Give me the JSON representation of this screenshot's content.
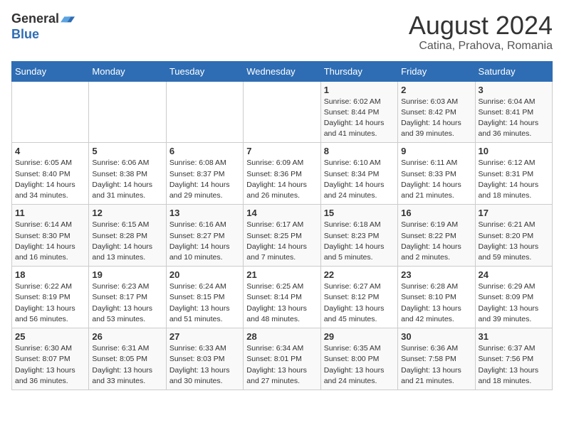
{
  "header": {
    "logo_general": "General",
    "logo_blue": "Blue",
    "month_title": "August 2024",
    "location": "Catina, Prahova, Romania"
  },
  "days_of_week": [
    "Sunday",
    "Monday",
    "Tuesday",
    "Wednesday",
    "Thursday",
    "Friday",
    "Saturday"
  ],
  "weeks": [
    [
      {
        "num": "",
        "info": ""
      },
      {
        "num": "",
        "info": ""
      },
      {
        "num": "",
        "info": ""
      },
      {
        "num": "",
        "info": ""
      },
      {
        "num": "1",
        "info": "Sunrise: 6:02 AM\nSunset: 8:44 PM\nDaylight: 14 hours\nand 41 minutes."
      },
      {
        "num": "2",
        "info": "Sunrise: 6:03 AM\nSunset: 8:42 PM\nDaylight: 14 hours\nand 39 minutes."
      },
      {
        "num": "3",
        "info": "Sunrise: 6:04 AM\nSunset: 8:41 PM\nDaylight: 14 hours\nand 36 minutes."
      }
    ],
    [
      {
        "num": "4",
        "info": "Sunrise: 6:05 AM\nSunset: 8:40 PM\nDaylight: 14 hours\nand 34 minutes."
      },
      {
        "num": "5",
        "info": "Sunrise: 6:06 AM\nSunset: 8:38 PM\nDaylight: 14 hours\nand 31 minutes."
      },
      {
        "num": "6",
        "info": "Sunrise: 6:08 AM\nSunset: 8:37 PM\nDaylight: 14 hours\nand 29 minutes."
      },
      {
        "num": "7",
        "info": "Sunrise: 6:09 AM\nSunset: 8:36 PM\nDaylight: 14 hours\nand 26 minutes."
      },
      {
        "num": "8",
        "info": "Sunrise: 6:10 AM\nSunset: 8:34 PM\nDaylight: 14 hours\nand 24 minutes."
      },
      {
        "num": "9",
        "info": "Sunrise: 6:11 AM\nSunset: 8:33 PM\nDaylight: 14 hours\nand 21 minutes."
      },
      {
        "num": "10",
        "info": "Sunrise: 6:12 AM\nSunset: 8:31 PM\nDaylight: 14 hours\nand 18 minutes."
      }
    ],
    [
      {
        "num": "11",
        "info": "Sunrise: 6:14 AM\nSunset: 8:30 PM\nDaylight: 14 hours\nand 16 minutes."
      },
      {
        "num": "12",
        "info": "Sunrise: 6:15 AM\nSunset: 8:28 PM\nDaylight: 14 hours\nand 13 minutes."
      },
      {
        "num": "13",
        "info": "Sunrise: 6:16 AM\nSunset: 8:27 PM\nDaylight: 14 hours\nand 10 minutes."
      },
      {
        "num": "14",
        "info": "Sunrise: 6:17 AM\nSunset: 8:25 PM\nDaylight: 14 hours\nand 7 minutes."
      },
      {
        "num": "15",
        "info": "Sunrise: 6:18 AM\nSunset: 8:23 PM\nDaylight: 14 hours\nand 5 minutes."
      },
      {
        "num": "16",
        "info": "Sunrise: 6:19 AM\nSunset: 8:22 PM\nDaylight: 14 hours\nand 2 minutes."
      },
      {
        "num": "17",
        "info": "Sunrise: 6:21 AM\nSunset: 8:20 PM\nDaylight: 13 hours\nand 59 minutes."
      }
    ],
    [
      {
        "num": "18",
        "info": "Sunrise: 6:22 AM\nSunset: 8:19 PM\nDaylight: 13 hours\nand 56 minutes."
      },
      {
        "num": "19",
        "info": "Sunrise: 6:23 AM\nSunset: 8:17 PM\nDaylight: 13 hours\nand 53 minutes."
      },
      {
        "num": "20",
        "info": "Sunrise: 6:24 AM\nSunset: 8:15 PM\nDaylight: 13 hours\nand 51 minutes."
      },
      {
        "num": "21",
        "info": "Sunrise: 6:25 AM\nSunset: 8:14 PM\nDaylight: 13 hours\nand 48 minutes."
      },
      {
        "num": "22",
        "info": "Sunrise: 6:27 AM\nSunset: 8:12 PM\nDaylight: 13 hours\nand 45 minutes."
      },
      {
        "num": "23",
        "info": "Sunrise: 6:28 AM\nSunset: 8:10 PM\nDaylight: 13 hours\nand 42 minutes."
      },
      {
        "num": "24",
        "info": "Sunrise: 6:29 AM\nSunset: 8:09 PM\nDaylight: 13 hours\nand 39 minutes."
      }
    ],
    [
      {
        "num": "25",
        "info": "Sunrise: 6:30 AM\nSunset: 8:07 PM\nDaylight: 13 hours\nand 36 minutes."
      },
      {
        "num": "26",
        "info": "Sunrise: 6:31 AM\nSunset: 8:05 PM\nDaylight: 13 hours\nand 33 minutes."
      },
      {
        "num": "27",
        "info": "Sunrise: 6:33 AM\nSunset: 8:03 PM\nDaylight: 13 hours\nand 30 minutes."
      },
      {
        "num": "28",
        "info": "Sunrise: 6:34 AM\nSunset: 8:01 PM\nDaylight: 13 hours\nand 27 minutes."
      },
      {
        "num": "29",
        "info": "Sunrise: 6:35 AM\nSunset: 8:00 PM\nDaylight: 13 hours\nand 24 minutes."
      },
      {
        "num": "30",
        "info": "Sunrise: 6:36 AM\nSunset: 7:58 PM\nDaylight: 13 hours\nand 21 minutes."
      },
      {
        "num": "31",
        "info": "Sunrise: 6:37 AM\nSunset: 7:56 PM\nDaylight: 13 hours\nand 18 minutes."
      }
    ]
  ]
}
